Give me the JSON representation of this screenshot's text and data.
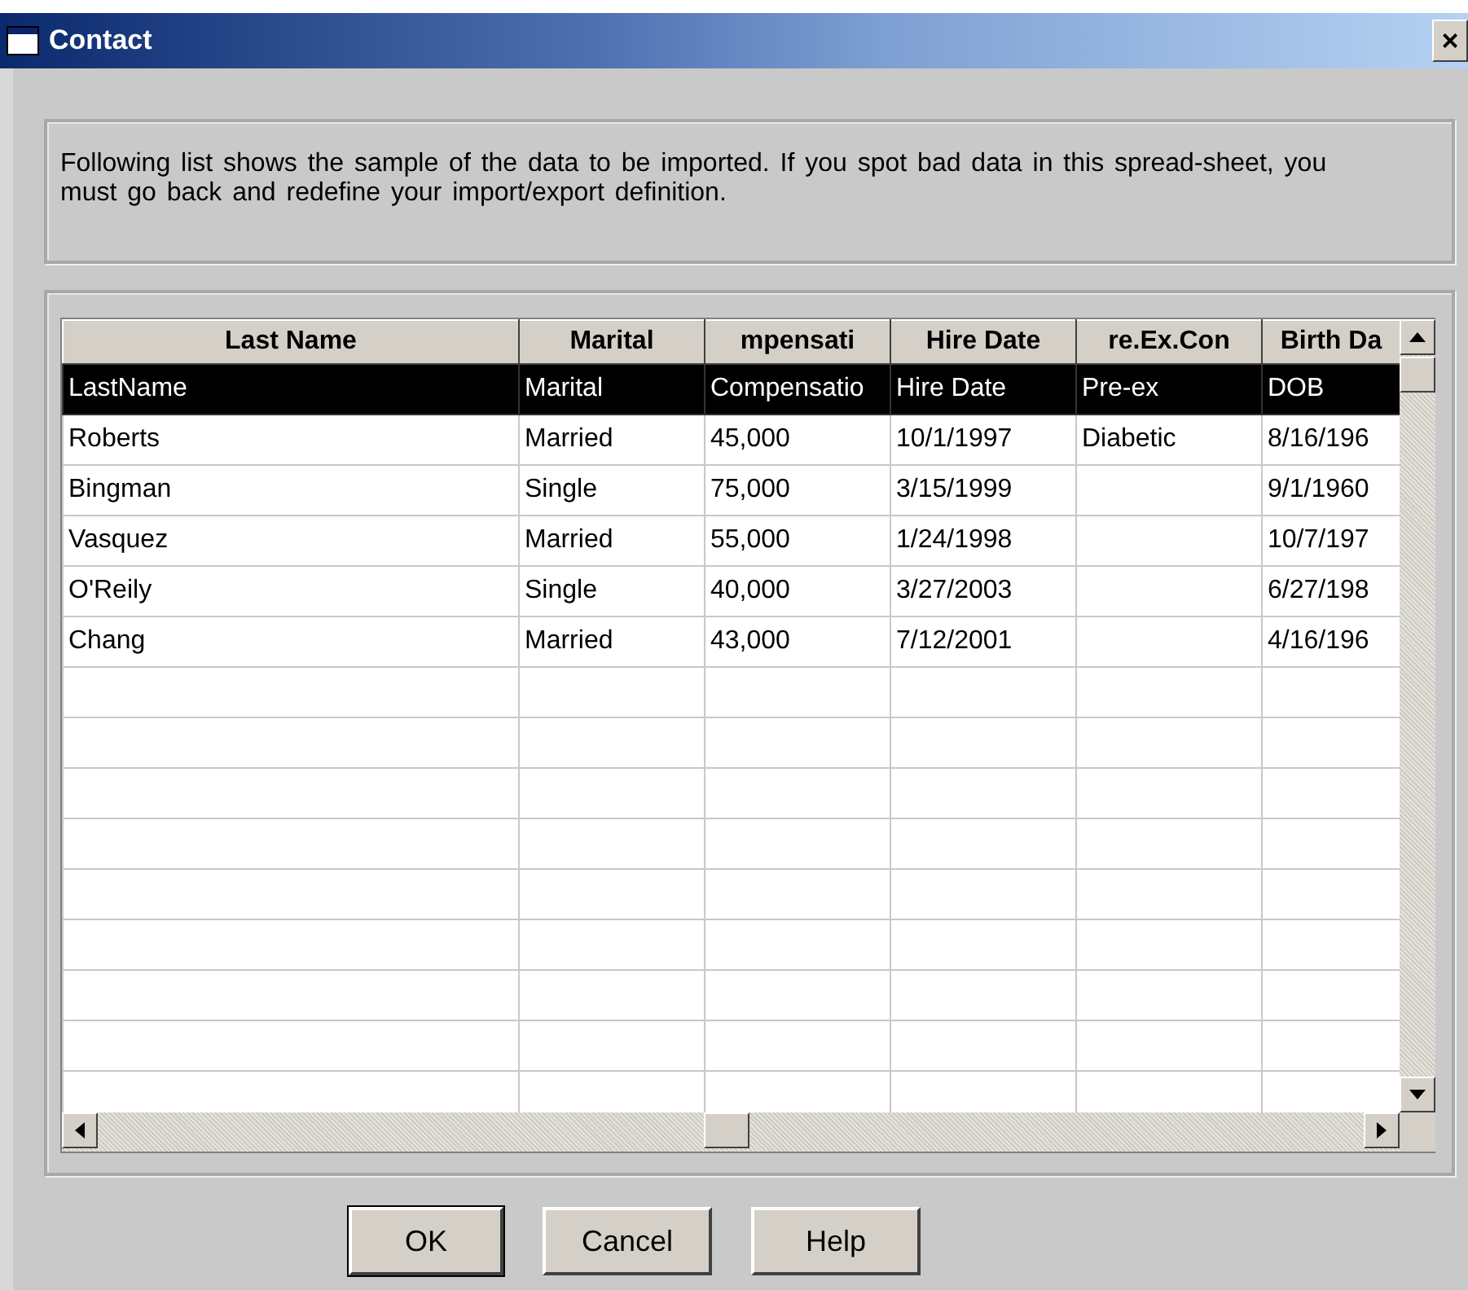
{
  "window": {
    "title": "Contact",
    "close": "×"
  },
  "message": "Following list shows the sample of the data to be imported. If you spot bad data in this spread-sheet, you must go back and redefine your import/export definition.",
  "table": {
    "columns": [
      "Last Name",
      "Marital",
      "mpensati",
      "Hire Date",
      "re.Ex.Con",
      "Birth Da"
    ],
    "rows": [
      {
        "selected": true,
        "cells": [
          "LastName",
          "Marital",
          "Compensatio",
          "Hire Date",
          "Pre-ex",
          "DOB"
        ]
      },
      {
        "selected": false,
        "cells": [
          "Roberts",
          "Married",
          "45,000",
          "10/1/1997",
          "Diabetic",
          "8/16/196"
        ]
      },
      {
        "selected": false,
        "cells": [
          "Bingman",
          "Single",
          "75,000",
          "3/15/1999",
          "",
          "9/1/1960"
        ]
      },
      {
        "selected": false,
        "cells": [
          "Vasquez",
          "Married",
          "55,000",
          "1/24/1998",
          "",
          "10/7/197"
        ]
      },
      {
        "selected": false,
        "cells": [
          "O'Reily",
          "Single",
          "40,000",
          "3/27/2003",
          "",
          "6/27/198"
        ]
      },
      {
        "selected": false,
        "cells": [
          "Chang",
          "Married",
          "43,000",
          "7/12/2001",
          "",
          "4/16/196"
        ]
      }
    ]
  },
  "buttons": [
    "OK",
    "Cancel",
    "Help"
  ]
}
